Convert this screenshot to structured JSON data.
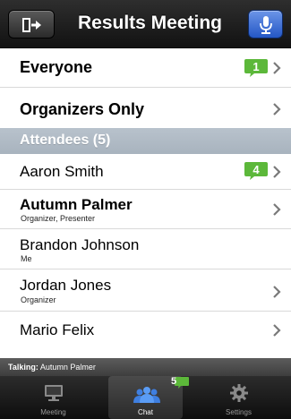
{
  "header": {
    "title": "Results Meeting",
    "back_icon": "exit-door-icon",
    "mic_icon": "microphone-icon",
    "accent": "#2f63d6"
  },
  "chat_targets": [
    {
      "label": "Everyone",
      "badge": "1"
    },
    {
      "label": "Organizers Only"
    }
  ],
  "attendees_header": "Attendees (5)",
  "attendees": [
    {
      "name": "Aaron Smith",
      "role": "",
      "badge": "4"
    },
    {
      "name": "Autumn Palmer",
      "role": "Organizer, Presenter"
    },
    {
      "name": "Brandon Johnson",
      "role": "Me"
    },
    {
      "name": "Jordan Jones",
      "role": "Organizer"
    },
    {
      "name": "Mario Felix",
      "role": ""
    }
  ],
  "status": {
    "talking_label": "Talking:",
    "talking_name": "Autumn Palmer"
  },
  "tabs": [
    {
      "label": "Meeting",
      "icon": "monitor-icon"
    },
    {
      "label": "Chat",
      "icon": "people-icon",
      "badge": "5",
      "active": true
    },
    {
      "label": "Settings",
      "icon": "gear-icon"
    }
  ],
  "badge_color": "#5cb83a"
}
